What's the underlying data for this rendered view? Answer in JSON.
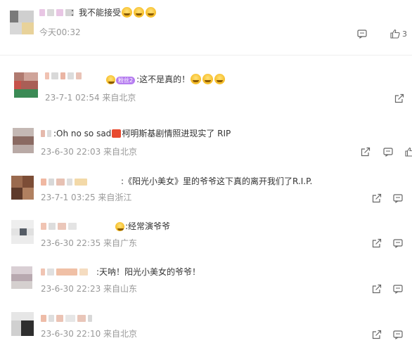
{
  "comments": [
    {
      "text": "：我不能接受",
      "time": "今天00:32",
      "like_count": "3"
    },
    {
      "badge": "粉丝2",
      "text": ":这不是真的！",
      "time": "23-7-1 02:54 来自北京"
    },
    {
      "text_a": ":Oh no so sad",
      "text_b": "柯明斯基剧情照进现实了 RIP",
      "time": "23-6-30 22:03 来自北京"
    },
    {
      "text": ":《阳光小美女》里的爷爷这下真的离开我们了R.I.P.",
      "time": "23-7-1 03:25 来自浙江"
    },
    {
      "text": ":经常演爷爷",
      "time": "23-6-30 22:35 来自广东"
    },
    {
      "text": ":天呐！阳光小美女的爷爷！",
      "time": "23-6-30 22:23 来自山东"
    },
    {
      "text": "",
      "time": "23-6-30 22:10 来自北京"
    }
  ],
  "icons": {
    "comment": "comment-icon",
    "like": "thumbs-up-icon",
    "share": "share-icon"
  }
}
